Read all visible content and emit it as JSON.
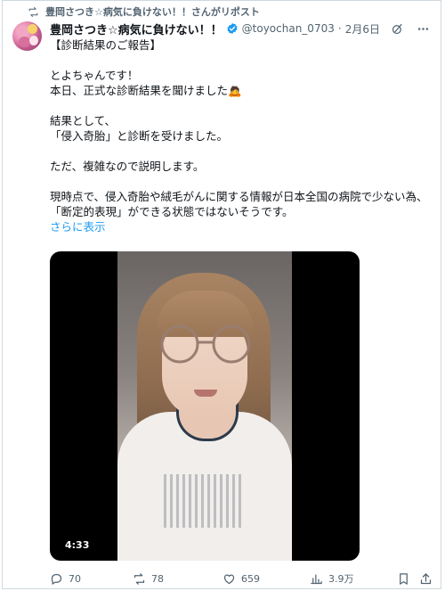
{
  "repost": {
    "text": "豊岡さつき☆病気に負けない！！さんがリポスト",
    "icon": "repost-icon"
  },
  "author": {
    "display_name": "豊岡さつき☆病気に負けない！！",
    "handle": "@toyochan_0703",
    "separator": "·",
    "time": "2月6日",
    "verified_color": "#1d9bf0"
  },
  "post": {
    "lines": [
      "【診断結果のご報告】",
      "",
      "とよちゃんです！",
      "本日、正式な診断結果を聞けました🙇",
      "",
      "結果として、",
      "「侵入奇胎」と診断を受けました。",
      "",
      "ただ、複雑なので説明します。",
      "",
      "現時点で、侵入奇胎や絨毛がんに関する情報が日本全国の病院で少ない為、",
      "「断定的表現」ができる状態ではないそうです。"
    ],
    "show_more": "さらに表示"
  },
  "video": {
    "duration": "4:33"
  },
  "actions": {
    "replies": "70",
    "reposts": "78",
    "likes": "659",
    "views": "3.9万"
  },
  "colors": {
    "accent": "#1d9bf0",
    "muted": "#536471",
    "text": "#0f1419"
  }
}
